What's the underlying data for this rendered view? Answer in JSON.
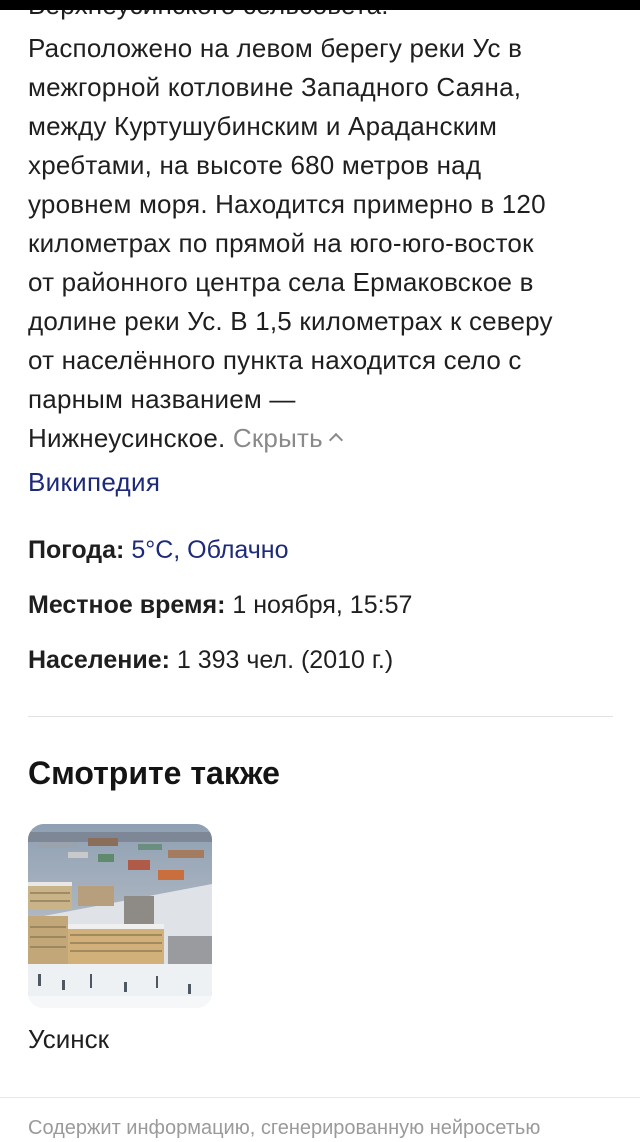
{
  "top_cut_line": "Верхнеусинского сельсовета.",
  "description_lines": [
    "Расположено на левом берегу реки Ус в",
    "межгорной котловине Западного Саяна,",
    "между Куртушубинским и Араданским",
    "хребтами, на высоте 680 метров над",
    "уровнем моря. Находится примерно в 120",
    "километрах по прямой на юго-юго-восток",
    "от районного центра села Ермаковское в",
    "долине реки Ус. В 1,5 километрах к северу",
    "от населённого пункта находится село с",
    "парным названием —"
  ],
  "description_last": "Нижнеусинское.",
  "hide_label": "Скрыть",
  "source_link": "Википедия",
  "facts": {
    "weather_label": "Погода:",
    "weather_value": "5°C, Облачно",
    "time_label": "Местное время:",
    "time_value": "1 ноября, 15:57",
    "population_label": "Население:",
    "population_value": "1 393 чел. (2010 г.)"
  },
  "see_also": {
    "title": "Смотрите также",
    "items": [
      {
        "label": "Усинск"
      }
    ]
  },
  "footer_text": "Содержит информацию, сгенерированную нейросетью",
  "colors": {
    "link": "#1d2a7a",
    "muted": "#8a8a8a",
    "text": "#1f1f1f"
  }
}
